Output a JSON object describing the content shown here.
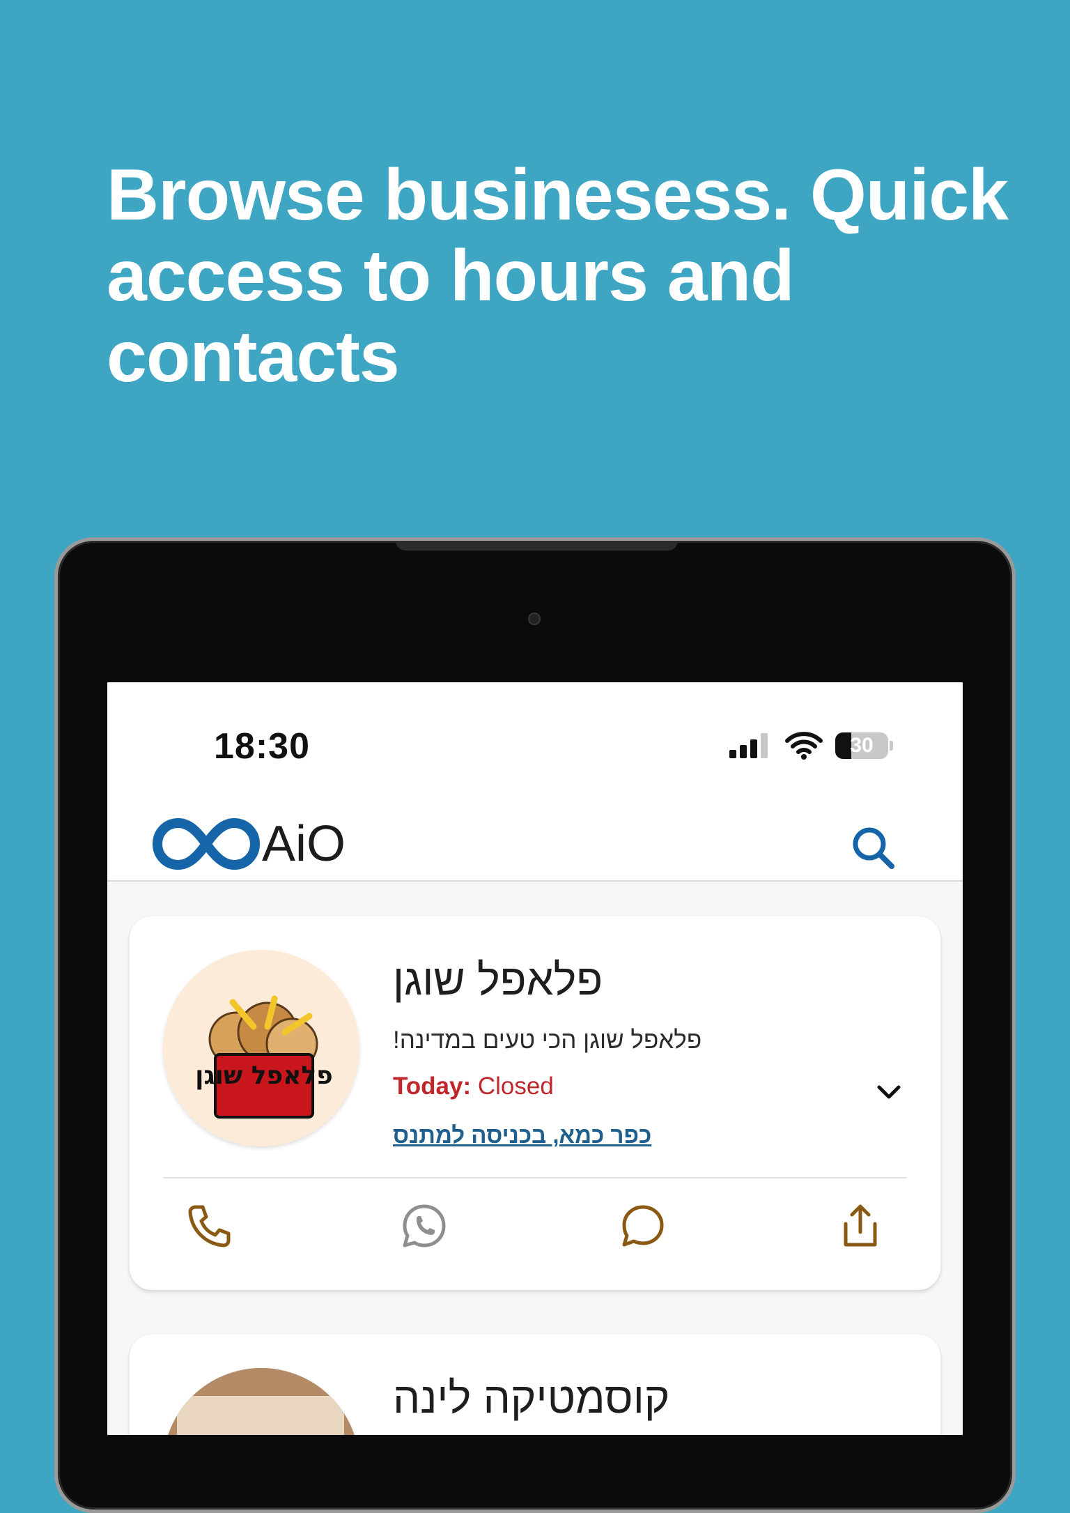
{
  "headline": "Browse businesess. Quick access to hours and contacts",
  "status_bar": {
    "time": "18:30",
    "battery_level": "30",
    "battery_fraction": 0.3
  },
  "app": {
    "logo_text": "AiO",
    "brand_color": "#1565a8"
  },
  "businesses": [
    {
      "name": "פלאפל שוגן",
      "description": "פלאפל שוגן הכי טעים במדינה!",
      "hours_label": "Today:",
      "hours_status": "Closed",
      "address": "כפר כמא, בכניסה למתנס",
      "logo_text": "פלאפל שוגן",
      "actions": [
        "phone-icon",
        "whatsapp-icon",
        "chat-icon",
        "share-icon"
      ]
    },
    {
      "name": "קוסמטיקה לינה"
    }
  ],
  "colors": {
    "background": "#3ea6c3",
    "action_icon": "#8a5a14",
    "closed_red": "#c0262a",
    "address_blue": "#1f5f8e"
  }
}
